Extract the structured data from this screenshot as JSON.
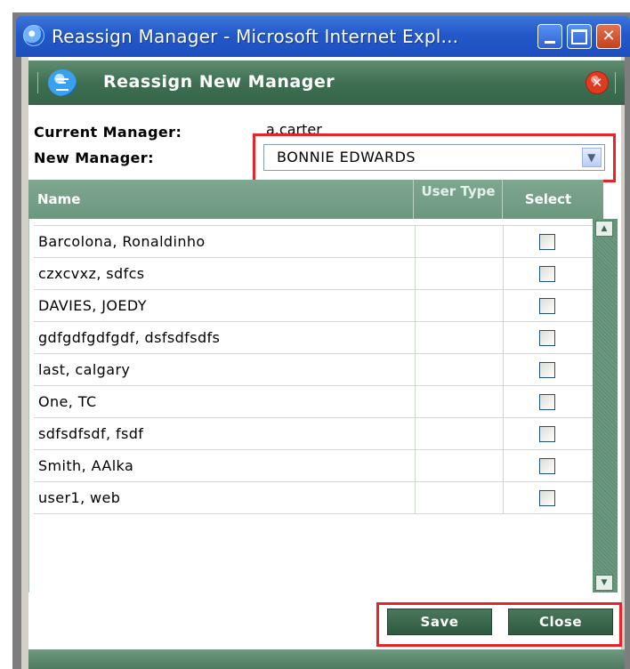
{
  "window": {
    "title": "Reassign Manager - Microsoft Internet Expl..."
  },
  "dialog": {
    "title": "Reassign New Manager",
    "current_manager_label": "Current Manager:",
    "current_manager_value": "a.carter",
    "new_manager_label": "New Manager:",
    "new_manager_selected": "BONNIE EDWARDS"
  },
  "grid": {
    "columns": {
      "name": "Name",
      "user_type": "User Type",
      "select": "Select"
    },
    "rows": [
      {
        "name": "Barcolona, Ronaldinho",
        "user_type": "",
        "selected": false
      },
      {
        "name": "czxcvxz, sdfcs",
        "user_type": "",
        "selected": false
      },
      {
        "name": "DAVIES, JOEDY",
        "user_type": "",
        "selected": false
      },
      {
        "name": "gdfgdfgdfgdf, dsfsdfsdfs",
        "user_type": "",
        "selected": false
      },
      {
        "name": "last, calgary",
        "user_type": "",
        "selected": false
      },
      {
        "name": "One, TC",
        "user_type": "",
        "selected": false
      },
      {
        "name": "sdfsdfsdf, fsdf",
        "user_type": "",
        "selected": false
      },
      {
        "name": "Smith, AAlka",
        "user_type": "",
        "selected": false
      },
      {
        "name": "user1, web",
        "user_type": "",
        "selected": false
      }
    ]
  },
  "buttons": {
    "save": "Save",
    "close": "Close"
  },
  "icons": {
    "window": "ie-icon",
    "dialog": "chat-bubble-icon",
    "dialog_close": "close-icon"
  },
  "colors": {
    "titlebar": "#2458c9",
    "dialog_header": "#3f6f52",
    "grid_header": "#7fa68f",
    "highlight": "#e8242b",
    "button": "#2d5a40"
  }
}
